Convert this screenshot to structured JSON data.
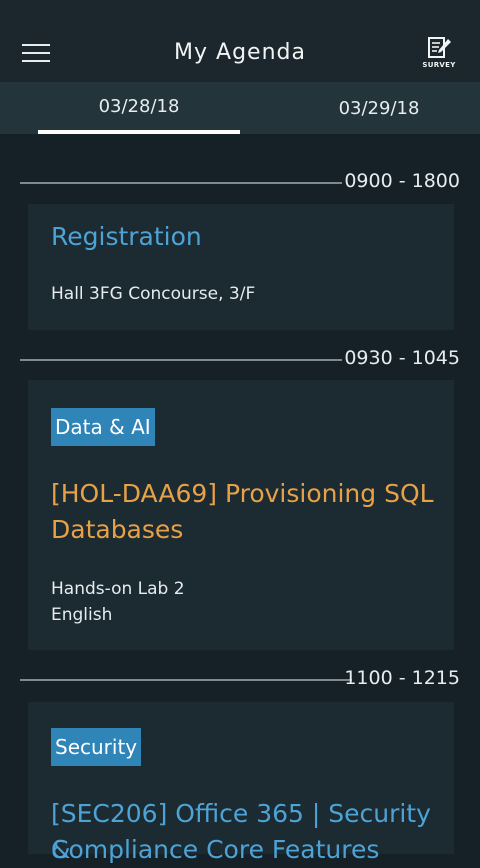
{
  "header": {
    "title": "My Agenda",
    "survey_label": "SURVEY"
  },
  "icons": {
    "menu": "hamburger-menu-icon",
    "survey": "survey-clipboard-icon"
  },
  "tabs": [
    {
      "label": "03/28/18",
      "selected": true
    },
    {
      "label": "03/29/18",
      "selected": false
    }
  ],
  "sessions": [
    {
      "time": "0900 - 1800",
      "title": "Registration",
      "location": "Hall 3FG Concourse, 3/F"
    },
    {
      "time": "0930 - 1045",
      "track": "Data & AI",
      "title_line1": "[HOL-DAA69] Provisioning SQL",
      "title_line2": "Databases",
      "room": "Hands-on Lab 2",
      "language": "English"
    },
    {
      "time": "1100 - 1215",
      "track": "Security",
      "title_line1": "[SEC206] Office 365 | Security &",
      "title_line2": "Compliance Core Features"
    }
  ],
  "colors": {
    "background": "#162127",
    "appbar": "#1b272d",
    "tabbar": "#24343b",
    "card": "#1c2a31",
    "link_blue": "#4ea3d6",
    "accent_orange": "#e7a147",
    "badge_blue": "#2f84b8"
  }
}
